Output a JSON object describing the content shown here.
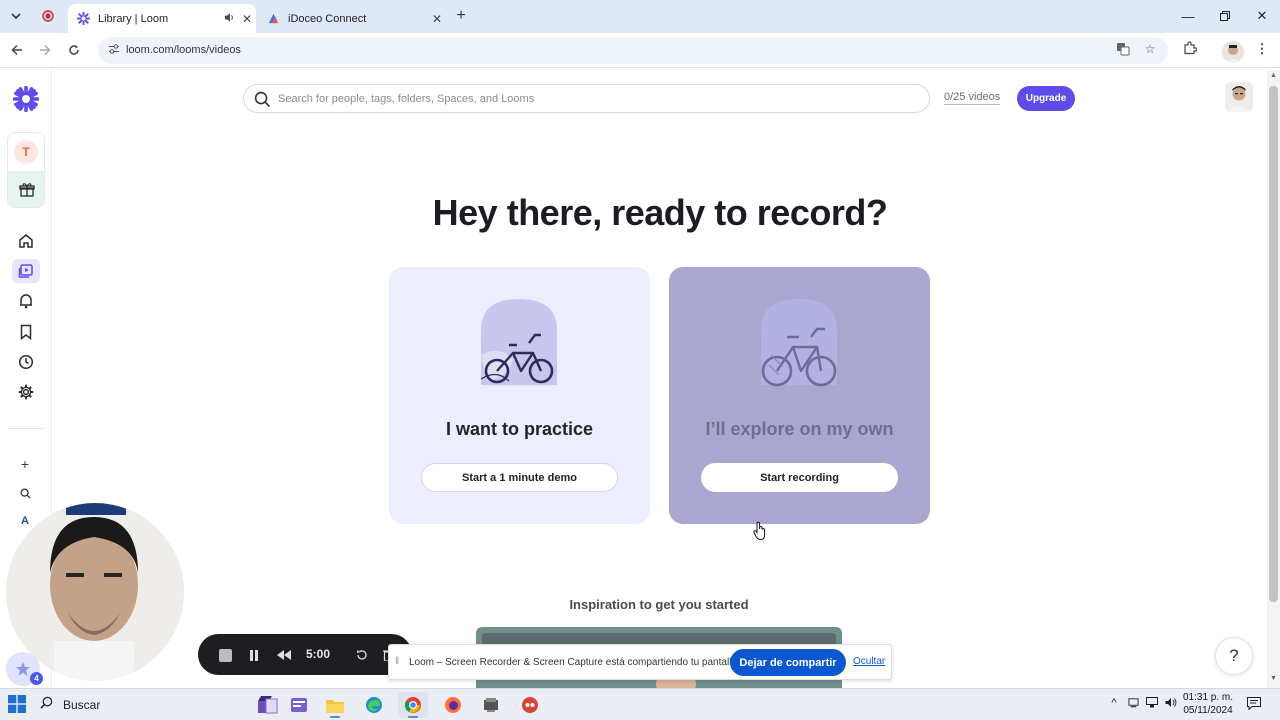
{
  "browser": {
    "tabs": [
      {
        "label": "Library | Loom",
        "active": true
      },
      {
        "label": "iDoceo Connect",
        "active": false
      }
    ],
    "new_tab_glyph": "+",
    "url": "loom.com/looms/videos"
  },
  "sidebar": {
    "workspace_initial": "T",
    "accent_color": "#5e4be8"
  },
  "search": {
    "placeholder": "Search for people, tags, folders, Spaces, and Looms"
  },
  "header": {
    "video_count": "0/25 videos",
    "upgrade_label": "Upgrade"
  },
  "main": {
    "headline": "Hey there, ready to record?",
    "cards": [
      {
        "title": "I want to practice",
        "button": "Start a 1 minute demo",
        "icon": "bicycle-icon"
      },
      {
        "title": "I’ll explore on my own",
        "button": "Start recording",
        "icon": "bicycle-icon"
      }
    ],
    "inspiration_title": "Inspiration to get you started"
  },
  "recorder": {
    "timer": "5:00"
  },
  "share_bar": {
    "message": "Loom – Screen Recorder & Screen Capture está compartiendo tu pantalla.",
    "stop_label": "Dejar de compartir",
    "hide_label": "Ocultar"
  },
  "help_label": "?",
  "loom_badge": "4",
  "taskbar": {
    "search_label": "Buscar",
    "time": "01:31 p. m.",
    "date": "05/11/2024"
  }
}
